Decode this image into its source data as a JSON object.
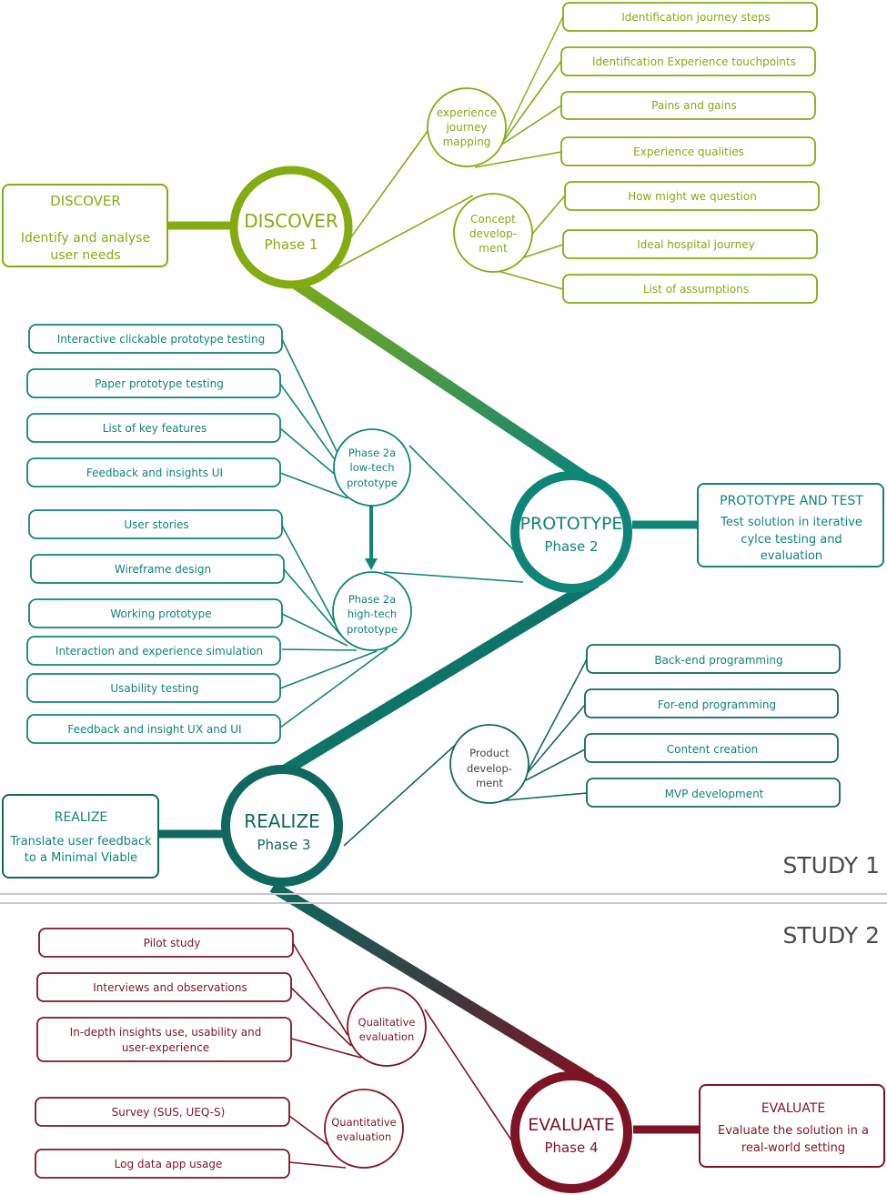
{
  "colors": {
    "discover": "#84ac12",
    "discover_light": "#8db928",
    "prototype": "#0f8478",
    "realize": "#10685f",
    "evaluate": "#7d1426",
    "divider": "#c9c9c9",
    "study_text": "#4a4a4a"
  },
  "study_labels": {
    "study1": "STUDY 1",
    "study2": "STUDY 2"
  },
  "phases": {
    "discover": {
      "circle_title": "DISCOVER",
      "circle_subtitle": "Phase 1",
      "box_title": "DISCOVER",
      "box_lines": [
        "Identify and analyse",
        "user needs"
      ],
      "subnodes": [
        {
          "label_lines": [
            "experience",
            "journey",
            "mapping"
          ],
          "items": [
            "Identification journey steps",
            "Identification Experience touchpoints",
            "Pains and gains",
            "Experience qualities"
          ]
        },
        {
          "label_lines": [
            "Concept",
            "develop-",
            "ment"
          ],
          "items": [
            "How might we question",
            "Ideal hospital journey",
            "List of assumptions"
          ]
        }
      ]
    },
    "prototype": {
      "circle_title": "PROTOTYPE",
      "circle_subtitle": "Phase  2",
      "box_title": "PROTOTYPE AND TEST",
      "box_lines": [
        "Test solution in iterative",
        "cylce testing and",
        "evaluation"
      ],
      "subnodes": [
        {
          "label_lines": [
            "Phase 2a",
            "low-tech",
            "prototype"
          ],
          "items": [
            "Interactive clickable prototype testing",
            "Paper prototype testing",
            "List of key features",
            "Feedback and insights UI"
          ]
        },
        {
          "label_lines": [
            "Phase 2a",
            "high-tech",
            "prototype"
          ],
          "items": [
            "User stories",
            "Wireframe design",
            "Working prototype",
            "Interaction and experience simulation",
            "Usability testing",
            "Feedback and insight UX and UI"
          ]
        }
      ]
    },
    "realize": {
      "circle_title": "REALIZE",
      "circle_subtitle": "Phase  3",
      "box_title": "REALIZE",
      "box_lines": [
        "Translate user feedback",
        "to a Minimal Viable"
      ],
      "subnodes": [
        {
          "label_lines": [
            "Product",
            "develop-",
            "ment"
          ],
          "items": [
            "Back-end programming",
            "For-end programming",
            "Content creation",
            "MVP development"
          ]
        }
      ]
    },
    "evaluate": {
      "circle_title": "EVALUATE",
      "circle_subtitle": "Phase  4",
      "box_title": "EVALUATE",
      "box_lines": [
        "Evaluate the solution in a",
        "real-world setting"
      ],
      "subnodes": [
        {
          "label_lines": [
            "Qualitative",
            "evaluation"
          ],
          "items": [
            "Pilot study",
            "Interviews and observations",
            [
              "In-depth insights use, usability and",
              "user-experience"
            ]
          ]
        },
        {
          "label_lines": [
            "Quantitative",
            "evaluation"
          ],
          "items": [
            "Survey (SUS, UEQ-S)",
            "Log data app usage"
          ]
        }
      ]
    }
  }
}
